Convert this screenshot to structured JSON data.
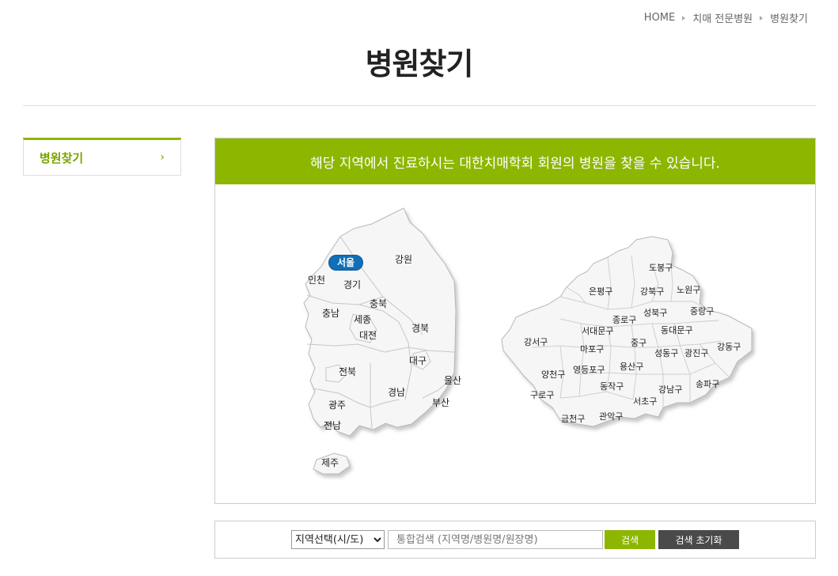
{
  "breadcrumb": [
    "HOME",
    "치매 전문병원",
    "병원찾기"
  ],
  "page_title": "병원찾기",
  "side_menu": {
    "label": "병원찾기",
    "chevron": "›"
  },
  "banner": "해당 지역에서 진료하시는 대한치매학회 회원의 병원을 찾을 수 있습니다.",
  "korea_map": {
    "regions": [
      "서울",
      "강원",
      "인천",
      "경기",
      "충북",
      "충남",
      "세종",
      "대전",
      "경북",
      "대구",
      "전북",
      "울산",
      "경남",
      "부산",
      "광주",
      "전남",
      "제주"
    ],
    "selected": "서울"
  },
  "seoul_map": {
    "districts": [
      "도봉구",
      "은평구",
      "강북구",
      "노원구",
      "성북구",
      "중랑구",
      "종로구",
      "서대문구",
      "동대문구",
      "강서구",
      "중구",
      "마포구",
      "성동구",
      "광진구",
      "강동구",
      "용산구",
      "양천구",
      "영등포구",
      "동작구",
      "강남구",
      "송파구",
      "구로구",
      "서초구",
      "금천구",
      "관악구"
    ]
  },
  "search": {
    "select_value": "지역선택(시/도)",
    "placeholder": "통합검색 (지역명/병원명/원장명)",
    "search_label": "검색",
    "reset_label": "검색 초기화"
  },
  "colors": {
    "accent": "#8db600",
    "selected_region": "#0f6fb8",
    "reset_button": "#4a4a4a"
  }
}
